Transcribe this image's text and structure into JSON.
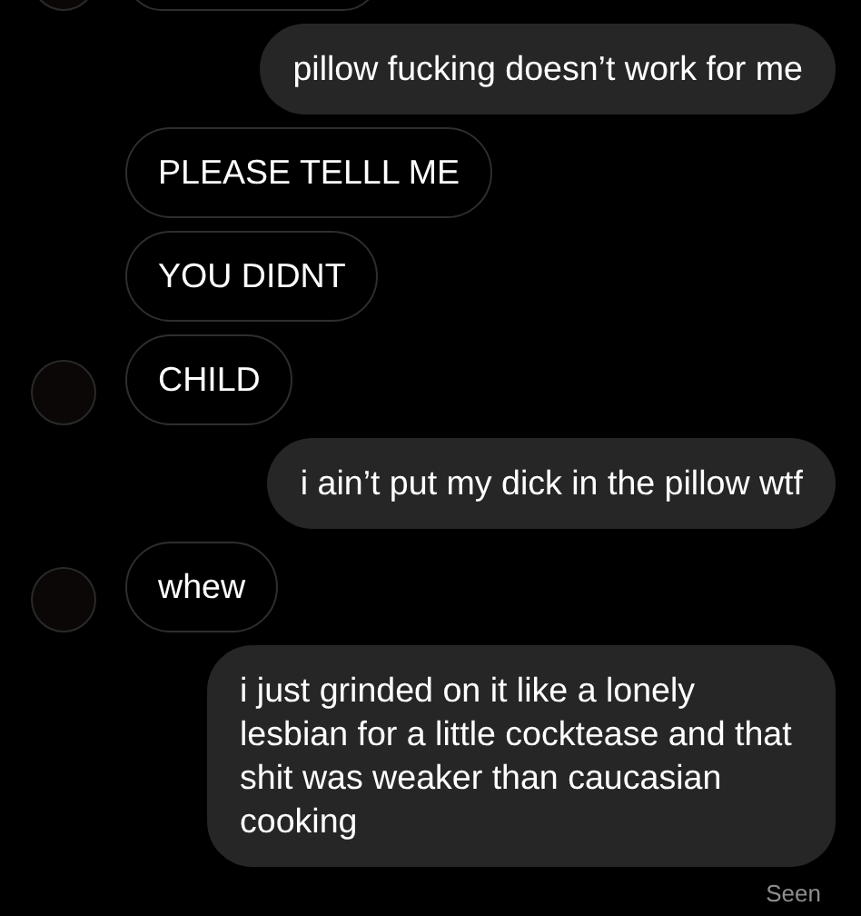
{
  "messages": [
    {
      "kind": "clipped",
      "avatar": true
    },
    {
      "kind": "outgoing",
      "text": "pillow fucking doesn’t work for me"
    },
    {
      "kind": "incoming",
      "text": "PLEASE TELLL ME",
      "avatar": false
    },
    {
      "kind": "incoming",
      "text": "YOU DIDNT",
      "avatar": false
    },
    {
      "kind": "incoming",
      "text": "CHILD",
      "avatar": true
    },
    {
      "kind": "outgoing",
      "text": "i ain’t put my dick in the pillow wtf"
    },
    {
      "kind": "incoming",
      "text": "whew",
      "avatar": true
    },
    {
      "kind": "outgoing",
      "text": "i just grinded on it like a lonely lesbian for a little cocktease and that shit was weaker than caucasian cooking"
    }
  ],
  "status": "Seen"
}
